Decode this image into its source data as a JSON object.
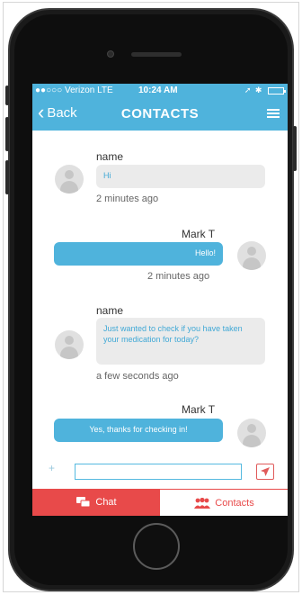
{
  "status_bar": {
    "carrier": "●●○○○ Verizon  LTE",
    "time": "10:24 AM",
    "indicators": "➚ ✱"
  },
  "nav": {
    "back_label": "Back",
    "title": "CONTACTS",
    "menu_icon": "hamburger-icon"
  },
  "messages": [
    {
      "direction": "in",
      "sender": "name",
      "text": "Hi",
      "time": "2 minutes ago"
    },
    {
      "direction": "out",
      "sender": "Mark T",
      "text": "Hello!",
      "time": "2 minutes ago"
    },
    {
      "direction": "in",
      "sender": "name",
      "text": "Just wanted to check if you have taken your medication for today?",
      "time": "a few seconds ago"
    },
    {
      "direction": "out",
      "sender": "Mark T",
      "text": "Yes, thanks for checking in!",
      "time": ""
    }
  ],
  "composer": {
    "plus_label": "+",
    "input_value": "",
    "send_icon": "send-arrow-icon"
  },
  "tabs": [
    {
      "label": "Chat",
      "icon": "chat-bubbles-icon",
      "active": true
    },
    {
      "label": "Contacts",
      "icon": "people-icon",
      "active": false
    }
  ],
  "colors": {
    "accent": "#4fb3dc",
    "tab_active": "#e84a4a",
    "bubble_in": "#ebebeb"
  }
}
